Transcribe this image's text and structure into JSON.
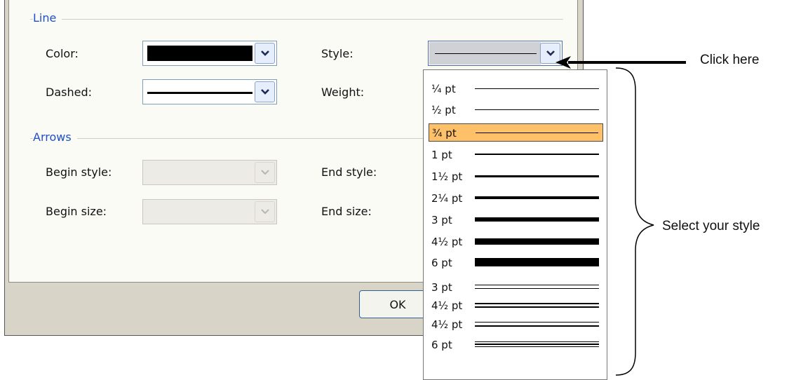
{
  "line_group": {
    "title": "Line",
    "color_label": "Color:",
    "style_label": "Style:",
    "dashed_label": "Dashed:",
    "weight_label": "Weight:"
  },
  "arrows_group": {
    "title": "Arrows",
    "begin_style_label": "Begin style:",
    "end_style_label": "End style:",
    "begin_size_label": "Begin size:",
    "end_size_label": "End size:"
  },
  "ok_label": "OK",
  "line_color": "#000000",
  "selected_color": "#ffc06a",
  "style_options": [
    {
      "label": "¼ pt",
      "style": "single"
    },
    {
      "label": "½ pt",
      "style": "single"
    },
    {
      "label": "¾ pt",
      "style": "single",
      "selected": true
    },
    {
      "label": "1 pt",
      "style": "single"
    },
    {
      "label": "1½ pt",
      "style": "single"
    },
    {
      "label": "2¼ pt",
      "style": "single"
    },
    {
      "label": "3 pt",
      "style": "single"
    },
    {
      "label": "4½ pt",
      "style": "single"
    },
    {
      "label": "6 pt",
      "style": "single"
    },
    {
      "label": "3 pt",
      "style": "double"
    },
    {
      "label": "4½ pt",
      "style": "double"
    },
    {
      "label": "4½ pt",
      "style": "double"
    },
    {
      "label": "6 pt",
      "style": "triple"
    }
  ],
  "annotations": {
    "click_here": "Click here",
    "select_style": "Select your style"
  }
}
